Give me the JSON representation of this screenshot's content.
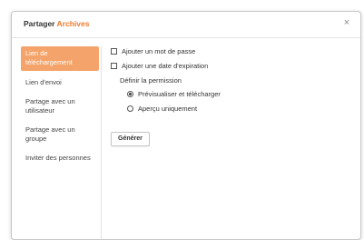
{
  "dialog": {
    "title_prefix": "Partager",
    "title_highlight": "Archives",
    "close_glyph": "×",
    "accent_color": "#eb7a2d",
    "active_nav_color": "#f4a46a"
  },
  "sidebar": {
    "items": [
      {
        "label": "Lien de téléchargement",
        "active": true
      },
      {
        "label": "Lien d'envoi",
        "active": false
      },
      {
        "label": "Partage avec un utilisateur",
        "active": false
      },
      {
        "label": "Partage avec un groupe",
        "active": false
      },
      {
        "label": "Inviter des personnes",
        "active": false
      }
    ]
  },
  "options": {
    "password_label": "Ajouter un mot de passe",
    "password_checked": false,
    "expiration_label": "Ajouter une date d'expiration",
    "expiration_checked": false,
    "permission_heading": "Définir la permission",
    "permission_options": [
      {
        "label": "Prévisualiser et télécharger",
        "selected": true
      },
      {
        "label": "Aperçu uniquement",
        "selected": false
      }
    ]
  },
  "actions": {
    "generate_label": "Générer"
  }
}
